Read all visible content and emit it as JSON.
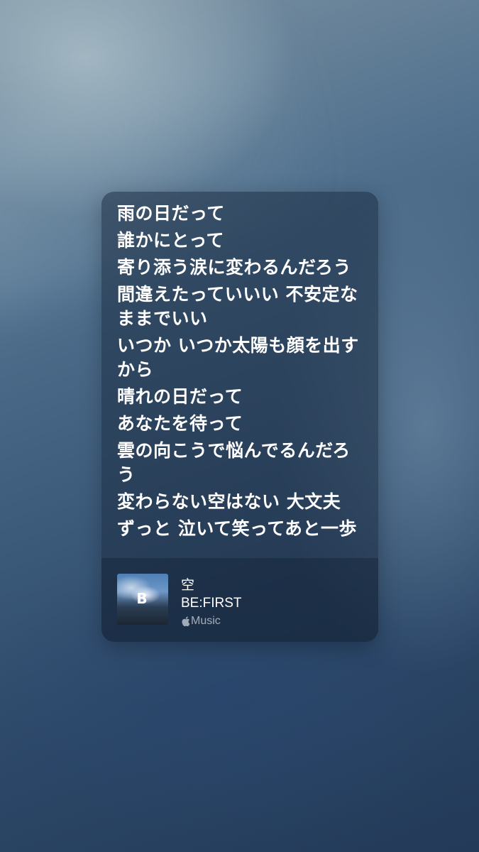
{
  "lyrics": [
    "雨の日だって",
    "誰かにとって",
    "寄り添う涙に変わるんだろう",
    "間違えたっていいい 不安定なままでいい",
    "いつか いつか太陽も顔を出すから",
    "晴れの日だって",
    "あなたを待って",
    "雲の向こうで悩んでるんだろう",
    "変わらない空はない 大文夫",
    "ずっと 泣いて笑ってあと一歩"
  ],
  "track": {
    "title": "空",
    "artist": "BE:FIRST",
    "service_label": "Music",
    "artwork_icon": "album-artwork",
    "artwork_logo": "B"
  },
  "colors": {
    "text": "#ffffff",
    "service_text": "#c3cbd6"
  }
}
